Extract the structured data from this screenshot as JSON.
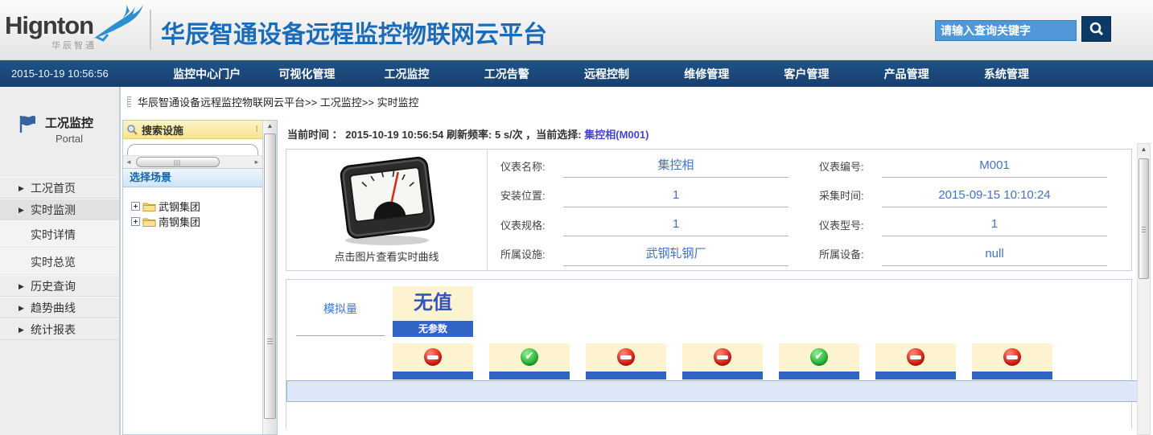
{
  "colors": {
    "nav_blue": "#1b4c80",
    "title_blue": "#1b6cb8",
    "search_input_blue": "#4f97d6",
    "search_btn_navy": "#0c3a67",
    "accent_bar_blue": "#3165c5",
    "value_blue": "#4472c4",
    "selection_blue": "#4545cf",
    "card_cream": "#fdf3d1",
    "ok_green": "#2fbb3f",
    "blocked_red": "#e02515",
    "highlight_row": "#dce8fa",
    "facility_header_yellow": "#f9e999",
    "scene_header_blue": "#d8e9f8"
  },
  "header": {
    "logo_text": "Hignton",
    "logo_subtext": "华辰智通",
    "title": "华辰智通设备远程监控物联网云平台",
    "search_placeholder": "请输入查询关键字"
  },
  "nav": {
    "timestamp": "2015-10-19 10:56:56",
    "items": [
      "监控中心门户",
      "可视化管理",
      "工况监控",
      "工况告警",
      "远程控制",
      "维修管理",
      "客户管理",
      "产品管理",
      "系统管理"
    ]
  },
  "sidebar": {
    "title": "工况监控",
    "subtitle": "Portal",
    "items": [
      {
        "label": "工况首页",
        "arrow": true,
        "active": false
      },
      {
        "label": "实时监测",
        "arrow": true,
        "active": true
      },
      {
        "label": "实时详情",
        "arrow": false,
        "active": false
      },
      {
        "label": "实时总览",
        "arrow": false,
        "active": false
      },
      {
        "label": "历史查询",
        "arrow": true,
        "active": false
      },
      {
        "label": "趋势曲线",
        "arrow": true,
        "active": false
      },
      {
        "label": "统计报表",
        "arrow": true,
        "active": false
      }
    ]
  },
  "breadcrumb": {
    "text": "华辰智通设备远程监控物联网云平台>> 工况监控>> 实时监控"
  },
  "facility": {
    "header": "搜索设施",
    "scene_header": "选择场景",
    "tree": [
      {
        "label": "武钢集团"
      },
      {
        "label": "南钢集团"
      }
    ]
  },
  "main": {
    "info": {
      "time_label": "当前时间 ：",
      "time_value": "2015-10-19 10:56:54",
      "refresh_text": "刷新频率: 5  s/次",
      "selection_label": "，当前选择:",
      "selection_value": "集控相(M001)"
    },
    "meter": {
      "caption": "点击图片查看实时曲线"
    },
    "fields": [
      {
        "label": "仪表名称:",
        "value": "集控相"
      },
      {
        "label": "安装位置:",
        "value": "1"
      },
      {
        "label": "仪表规格:",
        "value": "1"
      },
      {
        "label": "所属设施:",
        "value": "武钢轧钢厂"
      },
      {
        "label": "仪表编号:",
        "value": "M001"
      },
      {
        "label": "采集时间:",
        "value": "2015-09-15 10:10:24"
      },
      {
        "label": "仪表型号:",
        "value": "1"
      },
      {
        "label": "所属设备:",
        "value": "null"
      }
    ],
    "analog": {
      "label": "模拟量",
      "no_value": "无值",
      "no_param": "无参数",
      "statuses": [
        "blocked",
        "ok",
        "blocked",
        "blocked",
        "ok",
        "blocked",
        "blocked"
      ]
    }
  }
}
